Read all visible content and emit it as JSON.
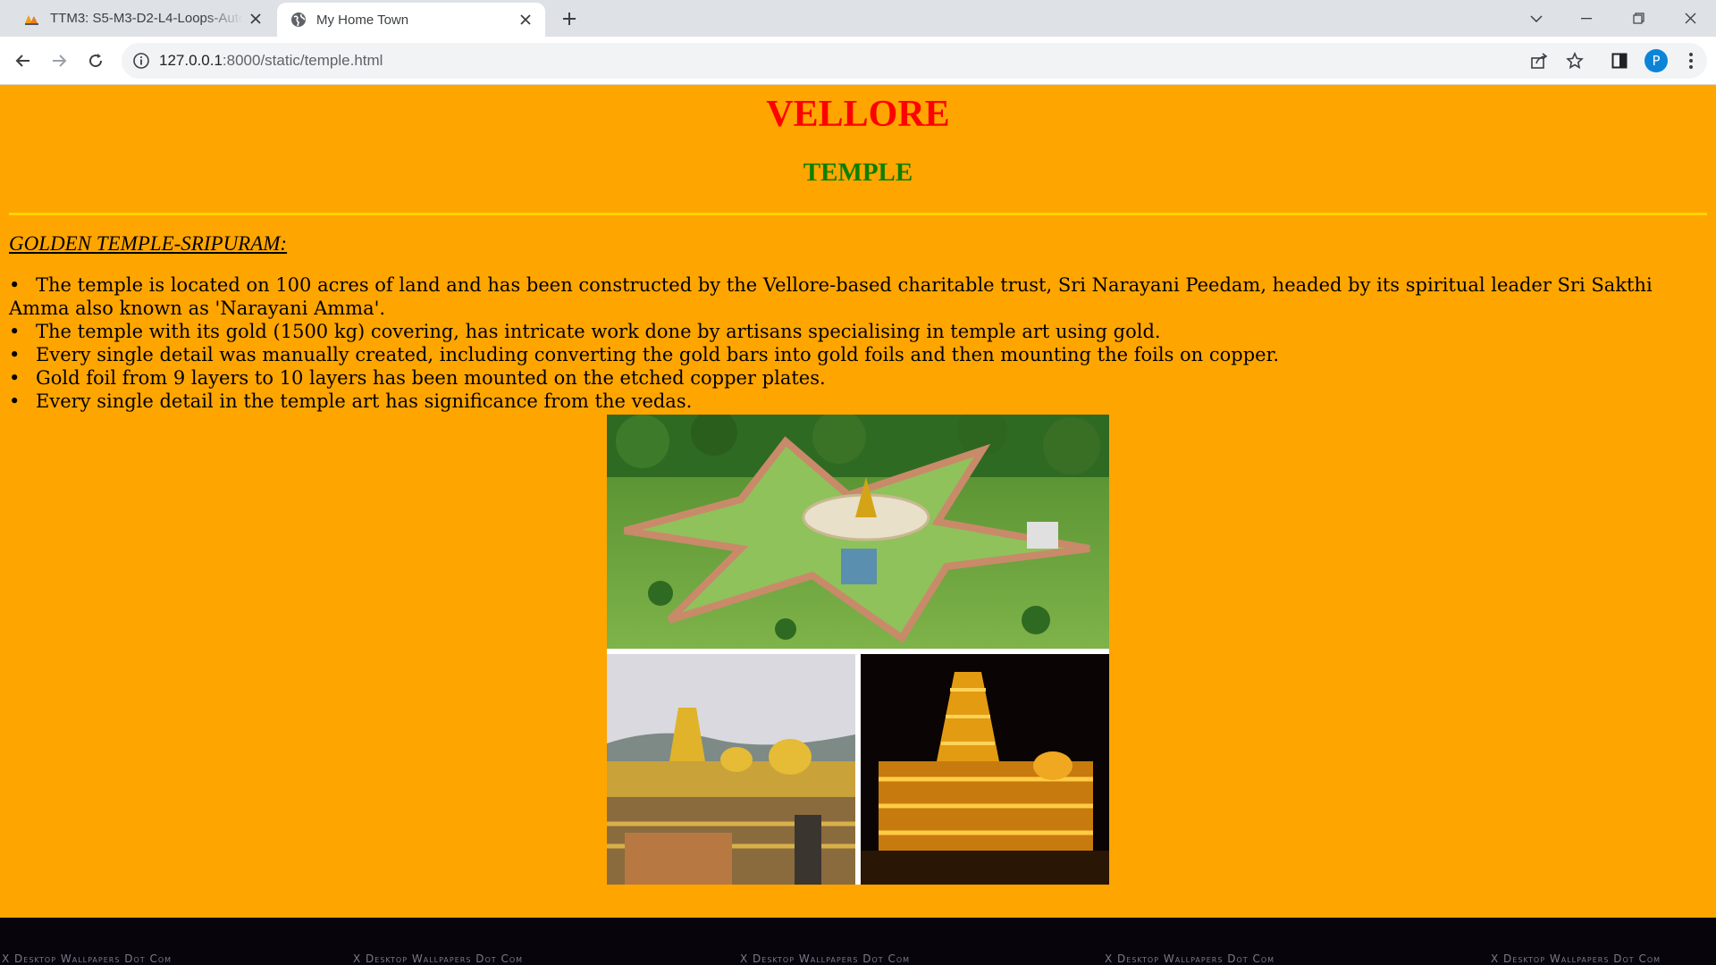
{
  "browser": {
    "tabs": [
      {
        "title": "TTM3: S5-M3-D2-L4-Loops-Auto",
        "active": false,
        "icon": "tutor-logo-icon"
      },
      {
        "title": "My Home Town",
        "active": true,
        "icon": "globe-icon"
      }
    ],
    "url_host": "127.0.0.1",
    "url_rest": ":8000/static/temple.html",
    "profile_initial": "P"
  },
  "page": {
    "heading": "VELLORE",
    "subheading": "TEMPLE",
    "section_title": "GOLDEN TEMPLE-SRIPURAM:",
    "bullets": [
      "The temple is located on 100 acres of land and has been constructed by the Vellore-based charitable trust, Sri Narayani Peedam, headed by its spiritual leader Sri Sakthi Amma also known as 'Narayani Amma'.",
      "The temple with its gold (1500 kg) covering, has intricate work done by artisans specialising in temple art using gold.",
      "Every single detail was manually created, including converting the gold bars into gold foils and then mounting the foils on copper.",
      "Gold foil from 9 layers to 10 layers has been mounted on the etched copper plates.",
      "Every single detail in the temple art has significance from the vedas."
    ],
    "watermark": "X Desktop Wallpapers Dot Com"
  },
  "colors": {
    "background": "#ffa500",
    "heading": "#ff0000",
    "subheading": "#0d8000",
    "rule": "#ffd700"
  }
}
